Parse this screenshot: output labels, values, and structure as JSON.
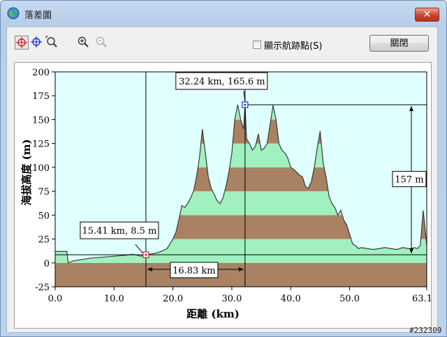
{
  "window": {
    "title": "落差圖",
    "close_label": "✕"
  },
  "toolbar": {
    "buttons": [
      {
        "name": "crosshair-red-icon"
      },
      {
        "name": "crosshair-blue-icon"
      },
      {
        "name": "zoom-region-icon"
      },
      {
        "name": "zoom-in-icon"
      },
      {
        "name": "zoom-out-icon"
      }
    ],
    "show_waypoints_label": "顯示航跡點(S)",
    "show_waypoints_checked": false,
    "close_button_label": "關閉"
  },
  "chart_data": {
    "type": "area",
    "xlabel": "距離  (km)",
    "ylabel": "海拔高度 (m)",
    "xlim": [
      0,
      63.1
    ],
    "ylim": [
      -25,
      200
    ],
    "x_ticks": [
      "0.0",
      "10.0",
      "20.0",
      "30.0",
      "40.0",
      "50.0",
      "63.1"
    ],
    "y_ticks": [
      "-25",
      "0",
      "25",
      "50",
      "75",
      "100",
      "125",
      "150",
      "175",
      "200"
    ],
    "x": [
      0,
      0.1,
      2,
      2.2,
      3,
      5,
      6,
      8,
      10,
      12,
      13,
      14,
      14.5,
      15,
      15.41,
      16,
      17,
      18,
      19,
      19.5,
      20,
      20.5,
      21,
      21.5,
      22,
      22.5,
      23,
      23.5,
      24,
      24.5,
      25,
      25.5,
      26,
      26.5,
      27,
      27.5,
      28,
      28.5,
      29,
      29.5,
      30,
      30.5,
      31,
      31.5,
      32,
      32.24,
      32.5,
      33,
      33.5,
      34,
      34.5,
      35,
      35.5,
      36,
      36.5,
      37,
      37.5,
      38,
      38.5,
      39,
      39.5,
      40,
      40.5,
      41,
      41.5,
      42,
      42.5,
      43,
      43.5,
      44,
      44.5,
      45,
      45.5,
      46,
      46.5,
      47,
      47.5,
      48,
      48.5,
      49,
      49.5,
      50,
      50.5,
      51,
      51.5,
      52,
      53,
      54,
      55,
      56,
      57,
      58,
      59,
      60,
      60.5,
      61,
      61.5,
      62,
      62.5,
      63.1
    ],
    "y": [
      12,
      12,
      12,
      0,
      2,
      4,
      5,
      6,
      7,
      8,
      9,
      8,
      7,
      8,
      8.5,
      9,
      10,
      12,
      15,
      20,
      25,
      32,
      45,
      60,
      58,
      62,
      68,
      75,
      90,
      110,
      140,
      115,
      90,
      78,
      72,
      65,
      62,
      68,
      80,
      95,
      115,
      150,
      165.6,
      150,
      140,
      165.6,
      130,
      125,
      118,
      122,
      135,
      118,
      120,
      125,
      145,
      165,
      150,
      125,
      118,
      115,
      110,
      100,
      98,
      95,
      92,
      90,
      80,
      78,
      85,
      100,
      120,
      138,
      105,
      90,
      70,
      62,
      58,
      50,
      55,
      45,
      40,
      30,
      20,
      18,
      15,
      16,
      15,
      14,
      15,
      16,
      15,
      14,
      16,
      15,
      15,
      16,
      15,
      18,
      55,
      18,
      20
    ]
  },
  "annotations": {
    "point_a_label": "15.41 km, 8.5 m",
    "point_b_label": "32.24 km, 165.6 m",
    "distance_label": "16.83 km",
    "height_diff_label": "157 m"
  },
  "colors": {
    "plot_bg": "#e0ffff",
    "band_a": "#a88262",
    "band_b": "#a0f0c0"
  },
  "watermark": "#232309"
}
